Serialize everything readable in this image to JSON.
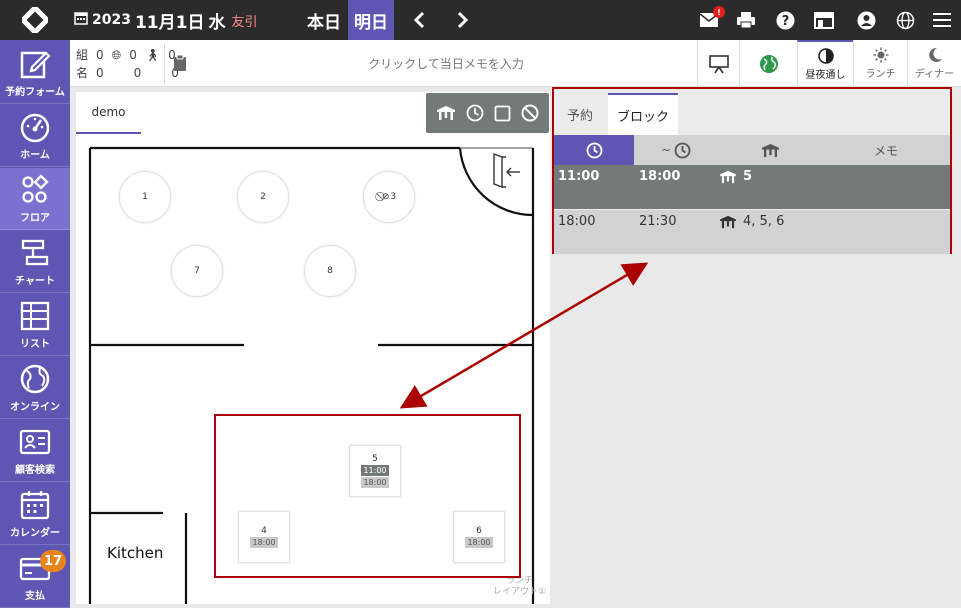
{
  "topbar": {
    "year": "2023",
    "month_day": "11月1日",
    "weekday": "水",
    "rokuyo": "友引",
    "today_label": "本日",
    "tomorrow_label": "明日",
    "mail_badge": "!"
  },
  "sidebar": {
    "items": [
      {
        "label": "予約フォーム",
        "icon": "edit-icon"
      },
      {
        "label": "ホーム",
        "icon": "gauge-icon"
      },
      {
        "label": "フロア",
        "icon": "shapes-icon"
      },
      {
        "label": "チャート",
        "icon": "chart-icon"
      },
      {
        "label": "リスト",
        "icon": "table-icon"
      },
      {
        "label": "オンライン",
        "icon": "globe-icon"
      },
      {
        "label": "顧客検索",
        "icon": "id-card-icon"
      },
      {
        "label": "カレンダー",
        "icon": "calendar-icon"
      },
      {
        "label": "支払",
        "icon": "card-icon",
        "badge": "17"
      }
    ]
  },
  "counts": {
    "row1_label": "組",
    "row2_label": "名",
    "groups": [
      "0",
      "0",
      "0"
    ],
    "people": [
      "0",
      "0",
      "0"
    ]
  },
  "memo": {
    "placeholder": "クリックして当日メモを入力"
  },
  "view_buttons": {
    "allday": "昼夜通し",
    "lunch": "ランチ",
    "dinner": "ディナー"
  },
  "floor": {
    "tab": "demo",
    "kitchen": "Kitchen",
    "layout_label_1": "ランチ",
    "layout_label_2": "レイアウト①",
    "round_tables": [
      {
        "label": "1"
      },
      {
        "label": "2"
      },
      {
        "label": "3",
        "blocked": true
      },
      {
        "label": "7"
      },
      {
        "label": "8"
      }
    ],
    "square_tables": [
      {
        "label": "5",
        "times": [
          {
            "text": "11:00",
            "style": "dark"
          },
          {
            "text": "18:00",
            "style": "light"
          }
        ]
      },
      {
        "label": "4",
        "times": [
          {
            "text": "18:00",
            "style": "light"
          }
        ]
      },
      {
        "label": "6",
        "times": [
          {
            "text": "18:00",
            "style": "light"
          }
        ]
      }
    ]
  },
  "right_panel": {
    "tabs": [
      "予約",
      "ブロック"
    ],
    "headers": {
      "start": "",
      "end": "~",
      "tables": "",
      "memo": "メモ"
    },
    "rows": [
      {
        "start": "11:00",
        "end": "18:00",
        "tables": "5",
        "memo": ""
      },
      {
        "start": "18:00",
        "end": "21:30",
        "tables": "4, 5, 6",
        "memo": ""
      }
    ]
  },
  "colors": {
    "accent": "#5e56b3",
    "topbar": "#2b2b2b",
    "annotation": "#aa0000"
  }
}
